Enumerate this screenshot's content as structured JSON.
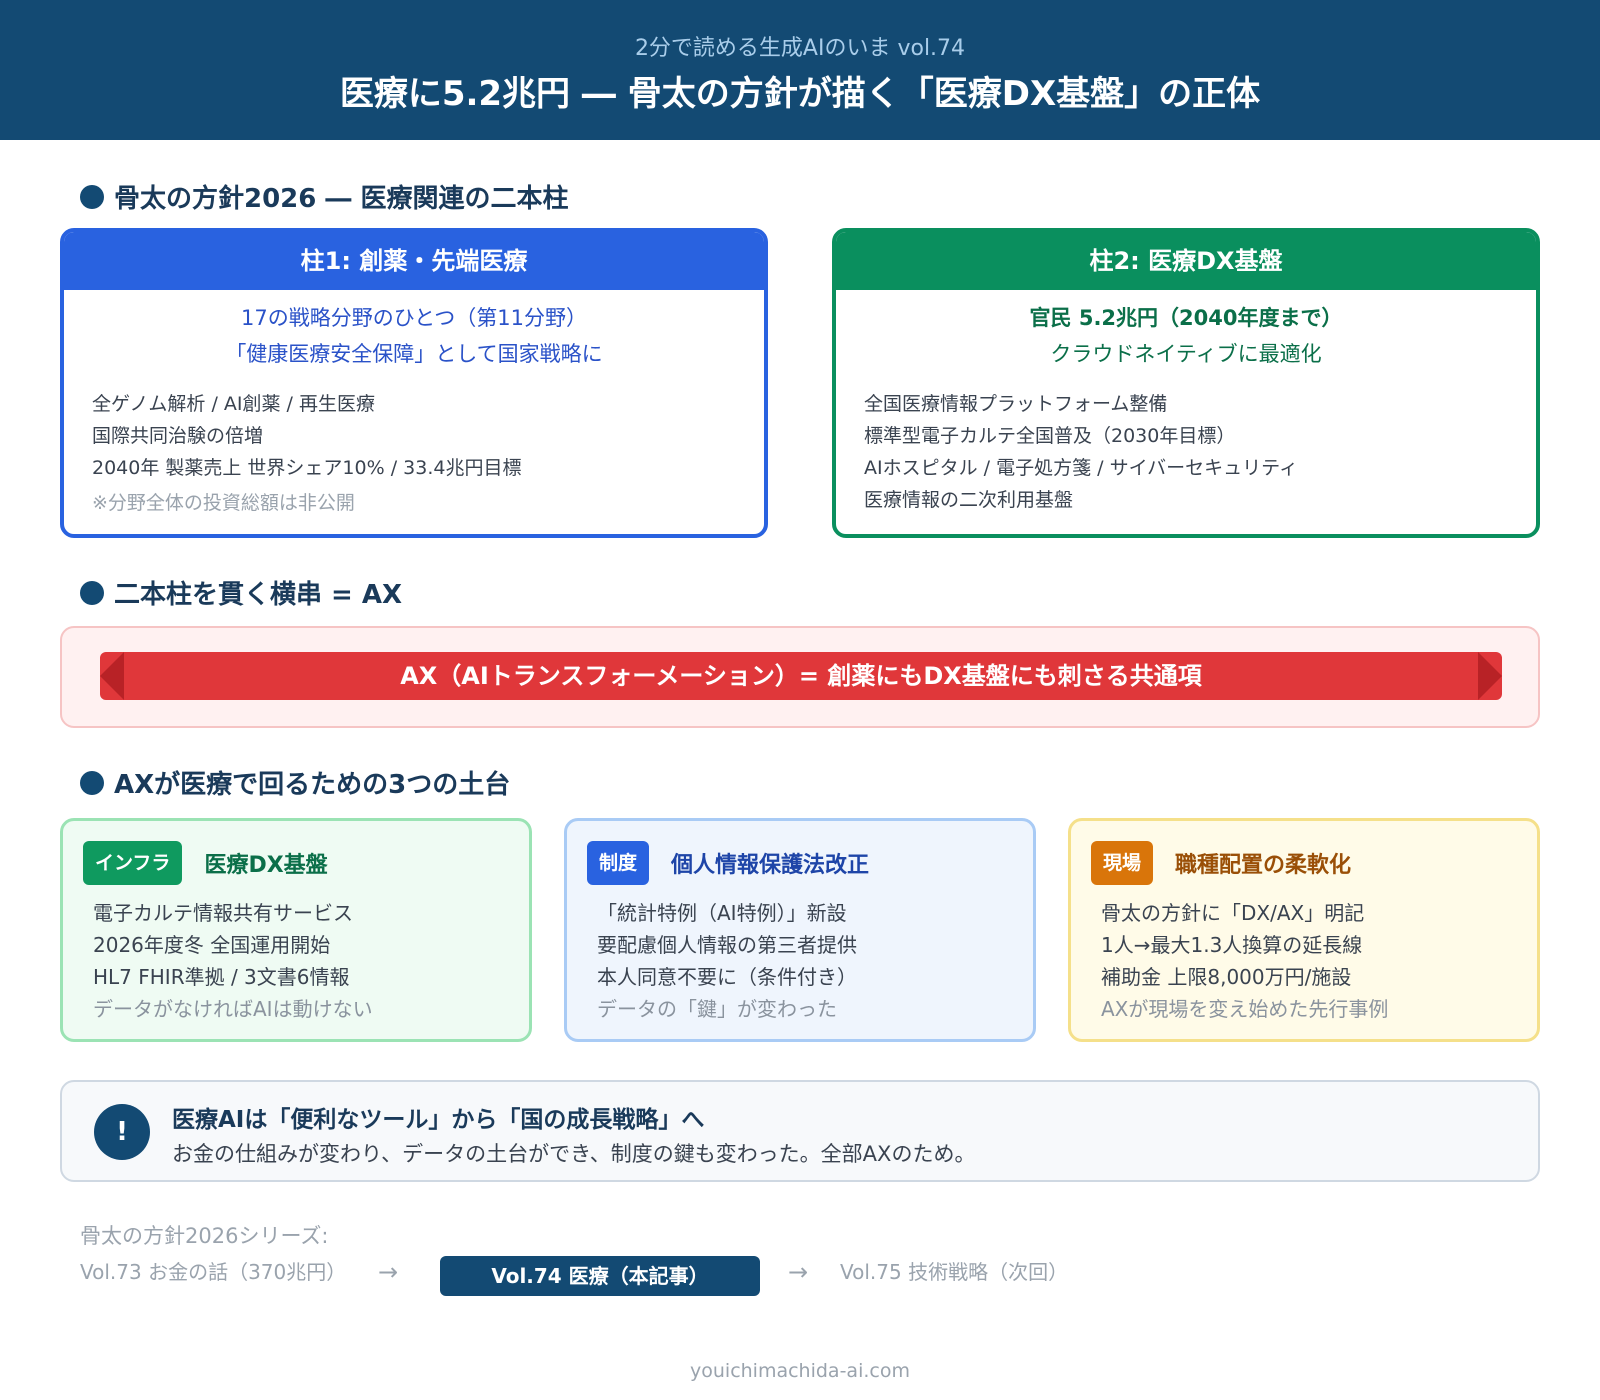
{
  "header": {
    "subtitle": "2分で読める生成AIのいま vol.74",
    "title": "医療に5.2兆円 ― 骨太の方針が描く「医療DX基盤」の正体"
  },
  "section1": {
    "title": "骨太の方針2026 ― 医療関連の二本柱"
  },
  "pillar1": {
    "title": "柱1: 創薬・先端医療",
    "lead1": "17の戦略分野のひとつ（第11分野）",
    "lead2": "「健康医療安全保障」として国家戦略に",
    "items": [
      "全ゲノム解析 / AI創薬 / 再生医療",
      "国際共同治験の倍増",
      "2040年 製薬売上 世界シェア10% / 33.4兆円目標"
    ],
    "note": "※分野全体の投資総額は非公開",
    "color": "#2962e0"
  },
  "pillar2": {
    "title": "柱2: 医療DX基盤",
    "lead1": "官民 5.2兆円（2040年度まで）",
    "lead2": "クラウドネイティブに最適化",
    "items": [
      "全国医療情報プラットフォーム整備",
      "標準型電子カルテ全国普及（2030年目標）",
      "AIホスピタル / 電子処方箋 / サイバーセキュリティ",
      "医療情報の二次利用基盤"
    ],
    "color": "#0a8f5e"
  },
  "section2": {
    "title": "二本柱を貫く横串 = AX"
  },
  "ax_band": {
    "text": "AX（AIトランスフォーメーション）= 創薬にもDX基盤にも刺さる共通項"
  },
  "section3": {
    "title": "AXが医療で回るための3つの土台"
  },
  "bases": [
    {
      "tag": "インフラ",
      "title": "医療DX基盤",
      "items": [
        "電子カルテ情報共有サービス",
        "2026年度冬 全国運用開始",
        "HL7 FHIR準拠 / 3文書6情報"
      ],
      "muted": "データがなければAIは動けない"
    },
    {
      "tag": "制度",
      "title": "個人情報保護法改正",
      "items": [
        "「統計特例（AI特例）」新設",
        "要配慮個人情報の第三者提供",
        "本人同意不要に（条件付き）"
      ],
      "muted": "データの「鍵」が変わった"
    },
    {
      "tag": "現場",
      "title": "職種配置の柔軟化",
      "items": [
        "骨太の方針に「DX/AX」明記",
        "1人→最大1.3人換算の延長線",
        "補助金 上限8,000万円/施設"
      ],
      "muted": "AXが現場を変え始めた先行事例"
    }
  ],
  "callout": {
    "icon": "!",
    "line1": "医療AIは「便利なツール」から「国の成長戦略」へ",
    "line2": "お金の仕組みが変わり、データの土台ができ、制度の鍵も変わった。全部AXのため。"
  },
  "series": {
    "label": "骨太の方針2026シリーズ:",
    "prev": "Vol.73 お金の話（370兆円）",
    "arrow": "→",
    "current": "Vol.74 医療（本記事）",
    "next": "Vol.75 技術戦略（次回）"
  },
  "footer": {
    "site": "youichimachida-ai.com"
  }
}
